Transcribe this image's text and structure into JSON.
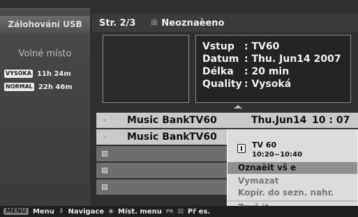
{
  "left_panel": {
    "title": "Zálohování USB",
    "free_space_label": "Volné místo",
    "qualities": [
      {
        "badge": "VYSOKA",
        "time": "11h 24m"
      },
      {
        "badge": "NORMAL",
        "time": "22h 46m"
      }
    ]
  },
  "header": {
    "page": "Str. 2/3",
    "unmarked_label": "Neoznaèeno"
  },
  "info": {
    "rows": [
      {
        "key": "Vstup",
        "value": ": TV60"
      },
      {
        "key": "Datum",
        "value": ": Thu. Jun14 2007"
      },
      {
        "key": "Délka",
        "value": ": 20 min"
      },
      {
        "key": "Quality",
        "value": ": Vysoká"
      }
    ]
  },
  "list": {
    "rows": [
      {
        "title": "Music Bank",
        "channel": "TV60",
        "date": "Thu.Jun14",
        "time": "10 : 07"
      },
      {
        "title": "Music Bank",
        "channel": "TV60",
        "date": "",
        "time": ""
      },
      {
        "title": "",
        "channel": "",
        "date": "",
        "time": ""
      },
      {
        "title": "",
        "channel": "",
        "date": "",
        "time": ""
      },
      {
        "title": "",
        "channel": "",
        "date": "",
        "time": ""
      }
    ]
  },
  "popup": {
    "channel": "TV 60",
    "time_range": "10:20~10:40",
    "items": [
      "Oznaèit vš e",
      "Vymazat",
      "Kopír. do sezn. nahr.",
      "Zruš it"
    ]
  },
  "bottom_bar": {
    "menu_key": "MENU",
    "menu_label": "Menu",
    "nav_label": "Navigace",
    "local_menu_label": "Míst. menu",
    "pr_small": "PR",
    "page_label": "Př es."
  }
}
